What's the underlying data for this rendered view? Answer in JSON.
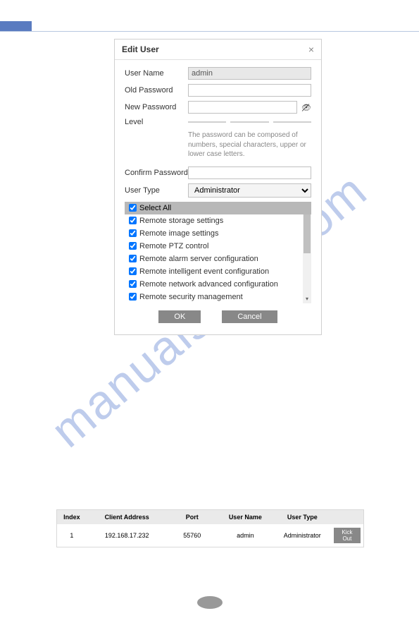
{
  "watermark": "manualshive.com",
  "dialog": {
    "title": "Edit User",
    "labels": {
      "username": "User Name",
      "old_password": "Old Password",
      "new_password": "New Password",
      "level": "Level",
      "confirm_password": "Confirm Password",
      "user_type": "User Type"
    },
    "username_value": "admin",
    "password_hint": "The password can be composed of numbers, special characters, upper or lower case letters.",
    "user_type_value": "Administrator",
    "select_all_label": "Select All",
    "permissions": [
      "Remote storage settings",
      "Remote image settings",
      "Remote PTZ control",
      "Remote alarm server configuration",
      "Remote intelligent event configuration",
      "Remote network advanced configuration",
      "Remote security management"
    ],
    "ok_label": "OK",
    "cancel_label": "Cancel"
  },
  "table": {
    "headers": {
      "index": "Index",
      "client_address": "Client Address",
      "port": "Port",
      "username": "User Name",
      "user_type": "User Type"
    },
    "row": {
      "index": "1",
      "client_address": "192.168.17.232",
      "port": "55760",
      "username": "admin",
      "user_type": "Administrator",
      "action": "Kick Out"
    }
  }
}
